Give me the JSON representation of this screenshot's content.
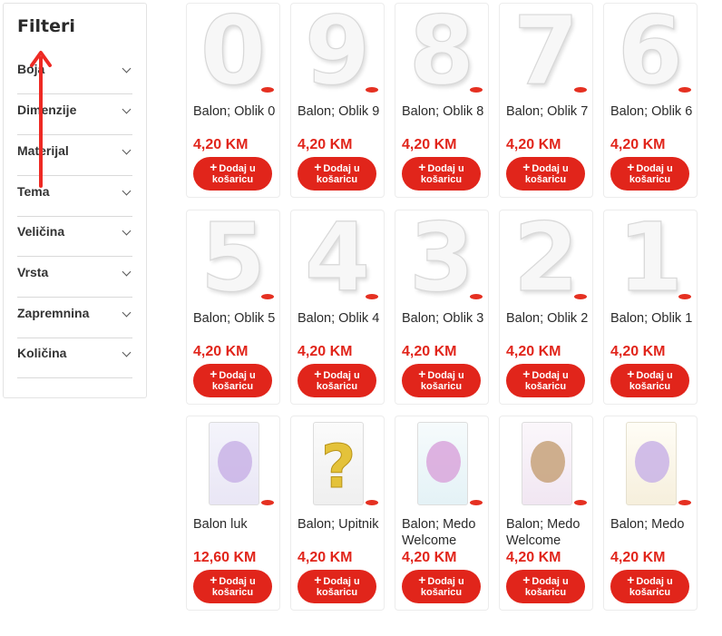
{
  "sidebar": {
    "title": "Filteri",
    "filters": [
      {
        "label": "Boja"
      },
      {
        "label": "Dimenzije"
      },
      {
        "label": "Materijal"
      },
      {
        "label": "Tema"
      },
      {
        "label": "Veličina"
      },
      {
        "label": "Vrsta"
      },
      {
        "label": "Zapremnina"
      },
      {
        "label": "Količina"
      }
    ]
  },
  "products": [
    {
      "digit": "0",
      "name": "Balon; Oblik 0",
      "price": "4,20 KM"
    },
    {
      "digit": "9",
      "name": "Balon; Oblik 9",
      "price": "4,20 KM"
    },
    {
      "digit": "8",
      "name": "Balon; Oblik 8",
      "price": "4,20 KM"
    },
    {
      "digit": "7",
      "name": "Balon; Oblik 7",
      "price": "4,20 KM"
    },
    {
      "digit": "6",
      "name": "Balon; Oblik 6",
      "price": "4,20 KM"
    },
    {
      "digit": "5",
      "name": "Balon; Oblik 5",
      "price": "4,20 KM"
    },
    {
      "digit": "4",
      "name": "Balon; Oblik 4",
      "price": "4,20 KM"
    },
    {
      "digit": "3",
      "name": "Balon; Oblik 3",
      "price": "4,20 KM"
    },
    {
      "digit": "2",
      "name": "Balon; Oblik 2",
      "price": "4,20 KM"
    },
    {
      "digit": "1",
      "name": "Balon; Oblik 1",
      "price": "4,20 KM"
    },
    {
      "digit": "",
      "name": "Balon luk",
      "price": "12,60 KM"
    },
    {
      "digit": "?",
      "name": "Balon; Upitnik",
      "price": "4,20 KM"
    },
    {
      "digit": "",
      "name": "Balon; Medo Welcome",
      "price": "4,20 KM"
    },
    {
      "digit": "",
      "name": "Balon; Medo Welcome",
      "price": "4,20 KM"
    },
    {
      "digit": "",
      "name": "Balon; Medo",
      "price": "4,20 KM"
    }
  ],
  "add_to_cart": {
    "line1": "Dodaj u",
    "line2": "košaricu",
    "plus": "+"
  },
  "colors": {
    "accent": "#e1251b",
    "border": "#ececec"
  }
}
